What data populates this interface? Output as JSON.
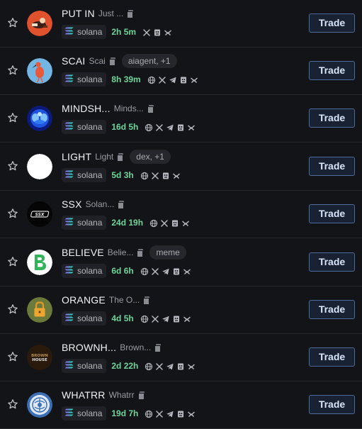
{
  "tokens": [
    {
      "ticker": "PUT IN",
      "name": "Just ...",
      "tag": "",
      "chain": "solana",
      "age": "2h 5m",
      "links": [
        "x-icon",
        "pumpfun-icon",
        "dexscreener-icon"
      ],
      "avatar": "putin-avatar"
    },
    {
      "ticker": "SCAI",
      "name": "Scai",
      "tag": "aiagent, +1",
      "chain": "solana",
      "age": "8h 39m",
      "links": [
        "globe-icon",
        "x-icon",
        "telegram-icon",
        "pumpfun-icon",
        "dexscreener-icon"
      ],
      "avatar": "bird-avatar"
    },
    {
      "ticker": "MINDSH...",
      "name": "Minds...",
      "tag": "",
      "chain": "solana",
      "age": "16d 5h",
      "links": [
        "globe-icon",
        "x-icon",
        "telegram-icon",
        "pumpfun-icon",
        "dexscreener-icon"
      ],
      "avatar": "mind-avatar"
    },
    {
      "ticker": "LIGHT",
      "name": "Light",
      "tag": "dex, +1",
      "chain": "solana",
      "age": "5d 3h",
      "links": [
        "globe-icon",
        "x-icon",
        "pumpfun-icon",
        "dexscreener-icon"
      ],
      "avatar": "white-circle-avatar"
    },
    {
      "ticker": "SSX",
      "name": "Solan...",
      "tag": "",
      "chain": "solana",
      "age": "24d 19h",
      "links": [
        "globe-icon",
        "x-icon",
        "pumpfun-icon",
        "dexscreener-icon"
      ],
      "avatar": "ssx-avatar"
    },
    {
      "ticker": "BELIEVE",
      "name": "Belie...",
      "tag": "meme",
      "chain": "solana",
      "age": "6d 6h",
      "links": [
        "globe-icon",
        "x-icon",
        "telegram-icon",
        "pumpfun-icon",
        "dexscreener-icon"
      ],
      "avatar": "believe-avatar"
    },
    {
      "ticker": "ORANGE",
      "name": "The O...",
      "tag": "",
      "chain": "solana",
      "age": "4d 5h",
      "links": [
        "globe-icon",
        "x-icon",
        "telegram-icon",
        "pumpfun-icon",
        "dexscreener-icon"
      ],
      "avatar": "lock-avatar"
    },
    {
      "ticker": "BROWNH...",
      "name": "Brown...",
      "tag": "",
      "chain": "solana",
      "age": "2d 22h",
      "links": [
        "globe-icon",
        "x-icon",
        "telegram-icon",
        "pumpfun-icon",
        "dexscreener-icon"
      ],
      "avatar": "brownhouse-avatar"
    },
    {
      "ticker": "WHATRR",
      "name": "Whatrr",
      "tag": "",
      "chain": "solana",
      "age": "19d 7h",
      "links": [
        "globe-icon",
        "x-icon",
        "telegram-icon",
        "pumpfun-icon",
        "dexscreener-icon"
      ],
      "avatar": "whatrr-avatar"
    }
  ],
  "trade_label": "Trade",
  "colors": {
    "background": "#131417",
    "age": "#6fd39a",
    "trade_border": "#4b6c9c",
    "trade_bg": "#182233"
  },
  "avatar_text": {
    "ssx": "SSX",
    "brownhouse_top": "BROWN",
    "brownhouse_bottom": "HOUSE"
  }
}
